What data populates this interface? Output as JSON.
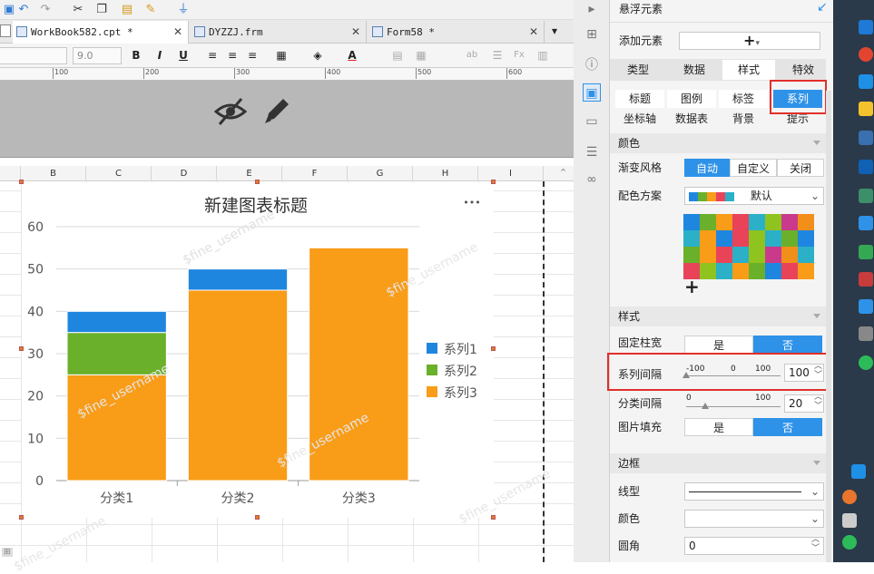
{
  "tabs": [
    {
      "label": "WorkBook582.cpt *",
      "close": "✕"
    },
    {
      "label": "DYZZJ.frm",
      "close": "✕"
    },
    {
      "label": "Form58 *",
      "close": "✕"
    }
  ],
  "format": {
    "font_size": "9.0"
  },
  "ruler": [
    "100",
    "200",
    "300",
    "400",
    "500",
    "600"
  ],
  "columns": [
    "B",
    "C",
    "D",
    "E",
    "F",
    "G",
    "H",
    "I"
  ],
  "chart_data": {
    "type": "bar",
    "stacked": true,
    "title": "新建图表标题",
    "categories": [
      "分类1",
      "分类2",
      "分类3"
    ],
    "series": [
      {
        "name": "系列3",
        "values": [
          25,
          45,
          55
        ],
        "color": "#f99c18"
      },
      {
        "name": "系列2",
        "values": [
          10,
          0,
          0
        ],
        "color": "#6ab02a"
      },
      {
        "name": "系列1",
        "values": [
          5,
          5,
          0
        ],
        "color": "#1f86e0"
      }
    ],
    "yticks": [
      "0",
      "10",
      "20",
      "30",
      "40",
      "50",
      "60"
    ],
    "ylim": [
      0,
      60
    ],
    "legend": "right",
    "grid": true,
    "legend_items": [
      "系列1",
      "系列2",
      "系列3"
    ],
    "more": "•••"
  },
  "watermark": "$fine_username",
  "panel": {
    "title": "悬浮元素",
    "add_element_label": "添加元素",
    "add_button": "+",
    "top_tabs": [
      "类型",
      "数据",
      "样式",
      "特效"
    ],
    "sub_tabs_row1": [
      "标题",
      "图例",
      "标签",
      "系列"
    ],
    "sub_tabs_row2": [
      "坐标轴",
      "数据表",
      "背景",
      "提示"
    ],
    "color_section": "颜色",
    "gradient_label": "渐变风格",
    "gradient_options": [
      "自动",
      "自定义",
      "关闭"
    ],
    "scheme_label": "配色方案",
    "scheme_value": "默认",
    "add_color": "+",
    "style_section": "样式",
    "fixed_width_label": "固定柱宽",
    "yes": "是",
    "no": "否",
    "series_gap_label": "系列间隔",
    "series_gap_ticks": [
      "-100",
      "0",
      "100"
    ],
    "series_gap_value": "100",
    "category_gap_label": "分类间隔",
    "category_gap_ticks": [
      "0",
      "100"
    ],
    "category_gap_value": "20",
    "image_fill_label": "图片填充",
    "border_section": "边框",
    "line_type_label": "线型",
    "border_color_label": "颜色",
    "corner_label": "圆角",
    "corner_value": "0"
  },
  "palette": [
    "#1f86e0",
    "#6ab02a",
    "#f99c18",
    "#e9435a",
    "#2bb0c8",
    "#8fc31f",
    "#c93a8c",
    "#f28f1b",
    "#2bb0c8",
    "#f99c18",
    "#1f86e0",
    "#e9435a",
    "#8fc31f",
    "#2bb0c8",
    "#6ab02a",
    "#1f86e0",
    "#6ab02a",
    "#f99c18",
    "#e9435a",
    "#2bb0c8",
    "#8fc31f",
    "#c93a8c",
    "#f28f1b",
    "#2bb0c8",
    "#e9435a",
    "#8fc31f",
    "#2bb0c8",
    "#f99c18",
    "#6ab02a",
    "#1f86e0",
    "#e9435a",
    "#f99c18"
  ]
}
